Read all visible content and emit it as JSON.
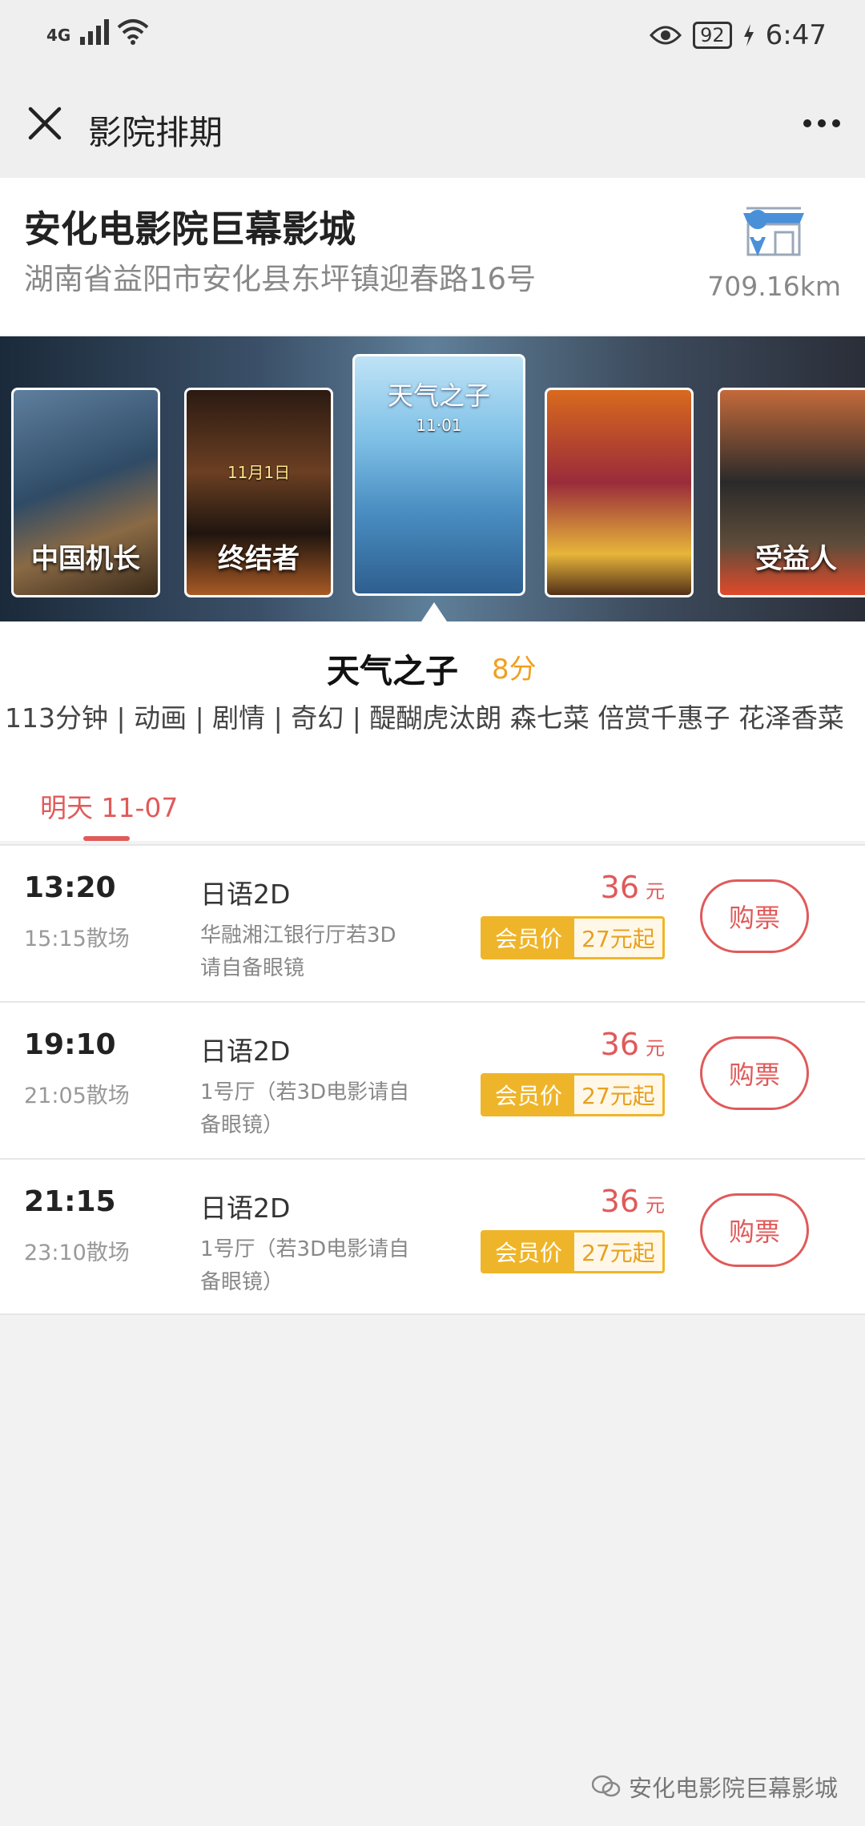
{
  "status_bar": {
    "network": "4G",
    "battery": "92",
    "time": "6:47"
  },
  "nav": {
    "title": "影院排期"
  },
  "cinema": {
    "name": "安化电影院巨幕影城",
    "address": "湖南省益阳市安化县东坪镇迎春路16号",
    "distance": "709.16km"
  },
  "posters": [
    {
      "title": "中国机长",
      "date": ""
    },
    {
      "title": "终结者",
      "date": "11月1日"
    },
    {
      "title": "天气之子",
      "date": "11·01"
    },
    {
      "title": "",
      "date": ""
    },
    {
      "title": "受益人",
      "date": ""
    }
  ],
  "movie": {
    "title": "天气之子",
    "score": "8分",
    "meta": "113分钟 |  动画 | 剧情 | 奇幻 |  醍醐虎汰朗 森七菜 倍赏千惠子 花泽香菜"
  },
  "date_tab": "明天 11-07",
  "showtimes": [
    {
      "start": "13:20",
      "end": "15:15散场",
      "lang": "日语2D",
      "hall": "华融湘江银行厅若3D请自备眼镜",
      "price": "36",
      "unit": "元",
      "member_label": "会员价",
      "member_price": "27元起",
      "buy": "购票"
    },
    {
      "start": "19:10",
      "end": "21:05散场",
      "lang": "日语2D",
      "hall": "1号厅（若3D电影请自备眼镜）",
      "price": "36",
      "unit": "元",
      "member_label": "会员价",
      "member_price": "27元起",
      "buy": "购票"
    },
    {
      "start": "21:15",
      "end": "23:10散场",
      "lang": "日语2D",
      "hall": "1号厅（若3D电影请自备眼镜）",
      "price": "36",
      "unit": "元",
      "member_label": "会员价",
      "member_price": "27元起",
      "buy": "购票"
    }
  ],
  "footer": "安化电影院巨幕影城",
  "colors": {
    "accent": "#e05a5a",
    "gold": "#efb52a",
    "score": "#f0a020"
  }
}
